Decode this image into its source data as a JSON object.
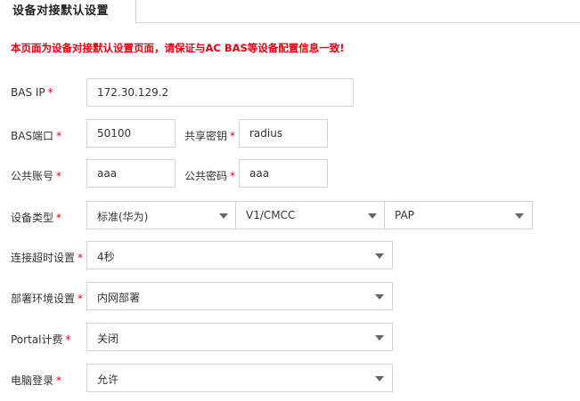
{
  "tab": {
    "title": "设备对接默认设置"
  },
  "notice": "本页面为设备对接默认设置页面，请保证与AC BAS等设备配置信息一致!",
  "required_mark": "*",
  "fields": {
    "bas_ip": {
      "label": "BAS IP",
      "value": "172.30.129.2"
    },
    "bas_port": {
      "label": "BAS端口",
      "value": "50100"
    },
    "shared_secret": {
      "label": "共享密钥",
      "value": "radius"
    },
    "public_account": {
      "label": "公共账号",
      "value": "aaa"
    },
    "public_password": {
      "label": "公共密码",
      "value": "aaa"
    },
    "device_type": {
      "label": "设备类型",
      "vendor": "标准(华为)",
      "version": "V1/CMCC",
      "auth": "PAP"
    },
    "timeout": {
      "label": "连接超时设置",
      "value": "4秒"
    },
    "deploy_env": {
      "label": "部署环境设置",
      "value": "内网部署"
    },
    "portal_billing": {
      "label": "Portal计费",
      "value": "关闭"
    },
    "pc_login": {
      "label": "电脑登录",
      "value": "允许"
    }
  },
  "icons": {
    "select_arrow": "chevron-down-icon"
  }
}
